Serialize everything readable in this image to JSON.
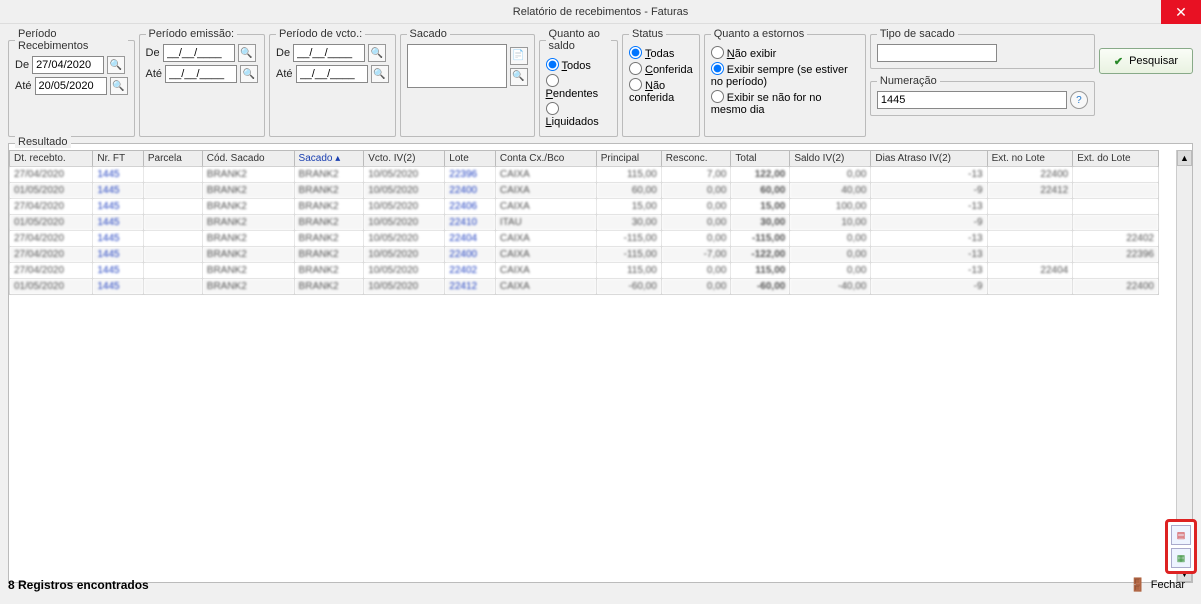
{
  "window": {
    "title": "Relatório de recebimentos - Faturas"
  },
  "filters": {
    "periodo_receb": {
      "legend": "Período Recebimentos",
      "de_label": "De",
      "ate_label": "Até",
      "de": "27/04/2020",
      "ate": "20/05/2020"
    },
    "periodo_emissao": {
      "legend": "Período emissão:",
      "de_label": "De",
      "ate_label": "Até",
      "de": "__/__/____",
      "ate": "__/__/____"
    },
    "periodo_vcto": {
      "legend": "Período de vcto.:",
      "de_label": "De",
      "ate_label": "Até",
      "de": "__/__/____",
      "ate": "__/__/____"
    },
    "sacado": {
      "legend": "Sacado",
      "value": ""
    },
    "saldo": {
      "legend": "Quanto ao saldo",
      "todos": "Todos",
      "pendentes": "Pendentes",
      "liquidados": "Liquidados",
      "selected": "todos"
    },
    "status": {
      "legend": "Status",
      "todas": "Todas",
      "conferida": "Conferida",
      "nao_conferida": "Não conferida",
      "selected": "todas"
    },
    "estornos": {
      "legend": "Quanto a estornos",
      "nao_exibir": "Não exibir",
      "exibir_sempre": "Exibir sempre (se estiver no período)",
      "exibir_se_nao": "Exibir se não for no mesmo dia",
      "selected": "exibir_sempre"
    },
    "tipo_sacado": {
      "legend": "Tipo de sacado",
      "value": ""
    },
    "numeracao": {
      "legend": "Numeração",
      "value": "1445"
    },
    "pesquisar": "Pesquisar"
  },
  "grid": {
    "legend": "Resultado",
    "columns": [
      "Dt. recebto.",
      "Nr. FT",
      "Parcela",
      "Cód. Sacado",
      "Sacado",
      "Vcto. IV(2)",
      "Lote",
      "Conta Cx./Bco",
      "Principal",
      "Resconc.",
      "Total",
      "Saldo IV(2)",
      "Dias Atraso IV(2)",
      "Ext. no Lote",
      "Ext. do Lote"
    ],
    "sorted_col": 4,
    "rows": [
      {
        "dt": "27/04/2020",
        "nr": "1445",
        "parc": "",
        "cod": "BRANK2",
        "sacado": "BRANK2",
        "vcto": "10/05/2020",
        "lote": "22396",
        "conta": "CAIXA",
        "princ": "115,00",
        "resc": "7,00",
        "total": "122,00",
        "saldo": "0,00",
        "dias": "-13",
        "extno": "22400",
        "extdo": ""
      },
      {
        "dt": "01/05/2020",
        "nr": "1445",
        "parc": "",
        "cod": "BRANK2",
        "sacado": "BRANK2",
        "vcto": "10/05/2020",
        "lote": "22400",
        "conta": "CAIXA",
        "princ": "60,00",
        "resc": "0,00",
        "total": "60,00",
        "saldo": "40,00",
        "dias": "-9",
        "extno": "22412",
        "extdo": ""
      },
      {
        "dt": "27/04/2020",
        "nr": "1445",
        "parc": "",
        "cod": "BRANK2",
        "sacado": "BRANK2",
        "vcto": "10/05/2020",
        "lote": "22406",
        "conta": "CAIXA",
        "princ": "15,00",
        "resc": "0,00",
        "total": "15,00",
        "saldo": "100,00",
        "dias": "-13",
        "extno": "",
        "extdo": ""
      },
      {
        "dt": "01/05/2020",
        "nr": "1445",
        "parc": "",
        "cod": "BRANK2",
        "sacado": "BRANK2",
        "vcto": "10/05/2020",
        "lote": "22410",
        "conta": "ITAU",
        "princ": "30,00",
        "resc": "0,00",
        "total": "30,00",
        "saldo": "10,00",
        "dias": "-9",
        "extno": "",
        "extdo": ""
      },
      {
        "dt": "27/04/2020",
        "nr": "1445",
        "parc": "",
        "cod": "BRANK2",
        "sacado": "BRANK2",
        "vcto": "10/05/2020",
        "lote": "22404",
        "conta": "CAIXA",
        "princ": "-115,00",
        "resc": "0,00",
        "total": "-115,00",
        "saldo": "0,00",
        "dias": "-13",
        "extno": "",
        "extdo": "22402"
      },
      {
        "dt": "27/04/2020",
        "nr": "1445",
        "parc": "",
        "cod": "BRANK2",
        "sacado": "BRANK2",
        "vcto": "10/05/2020",
        "lote": "22400",
        "conta": "CAIXA",
        "princ": "-115,00",
        "resc": "-7,00",
        "total": "-122,00",
        "saldo": "0,00",
        "dias": "-13",
        "extno": "",
        "extdo": "22396"
      },
      {
        "dt": "27/04/2020",
        "nr": "1445",
        "parc": "",
        "cod": "BRANK2",
        "sacado": "BRANK2",
        "vcto": "10/05/2020",
        "lote": "22402",
        "conta": "CAIXA",
        "princ": "115,00",
        "resc": "0,00",
        "total": "115,00",
        "saldo": "0,00",
        "dias": "-13",
        "extno": "22404",
        "extdo": ""
      },
      {
        "dt": "01/05/2020",
        "nr": "1445",
        "parc": "",
        "cod": "BRANK2",
        "sacado": "BRANK2",
        "vcto": "10/05/2020",
        "lote": "22412",
        "conta": "CAIXA",
        "princ": "-60,00",
        "resc": "0,00",
        "total": "-60,00",
        "saldo": "-40,00",
        "dias": "-9",
        "extno": "",
        "extdo": "22400"
      }
    ]
  },
  "footer": {
    "count_text": "8 Registros encontrados",
    "close": "Fechar"
  },
  "export": {
    "pdf": "PDF",
    "xls": "XLS"
  }
}
